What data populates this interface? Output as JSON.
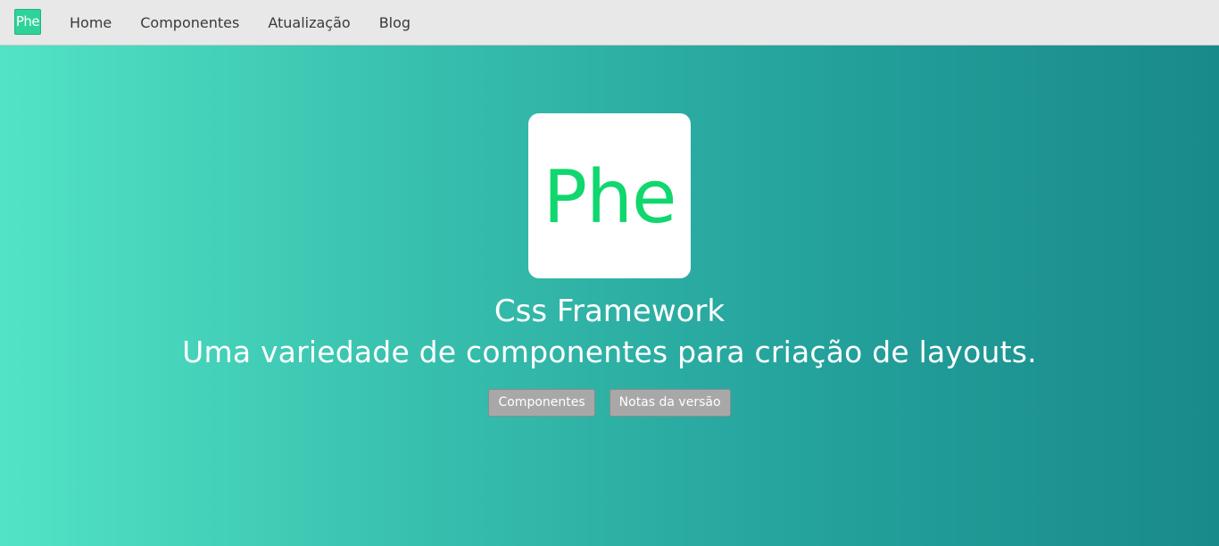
{
  "navbar": {
    "logo_text": "Phe",
    "links": [
      "Home",
      "Componentes",
      "Atualização",
      "Blog"
    ]
  },
  "hero": {
    "logo_text": "Phe",
    "title": "Css Framework",
    "subtitle": "Uma variedade de componentes para criação de layouts.",
    "buttons": [
      "Componentes",
      "Notas da versão"
    ]
  },
  "colors": {
    "logo_green": "#10d76e",
    "gradient_start": "#52e3c6",
    "gradient_end": "#188a8a",
    "button_gray": "#a8a8a8"
  }
}
